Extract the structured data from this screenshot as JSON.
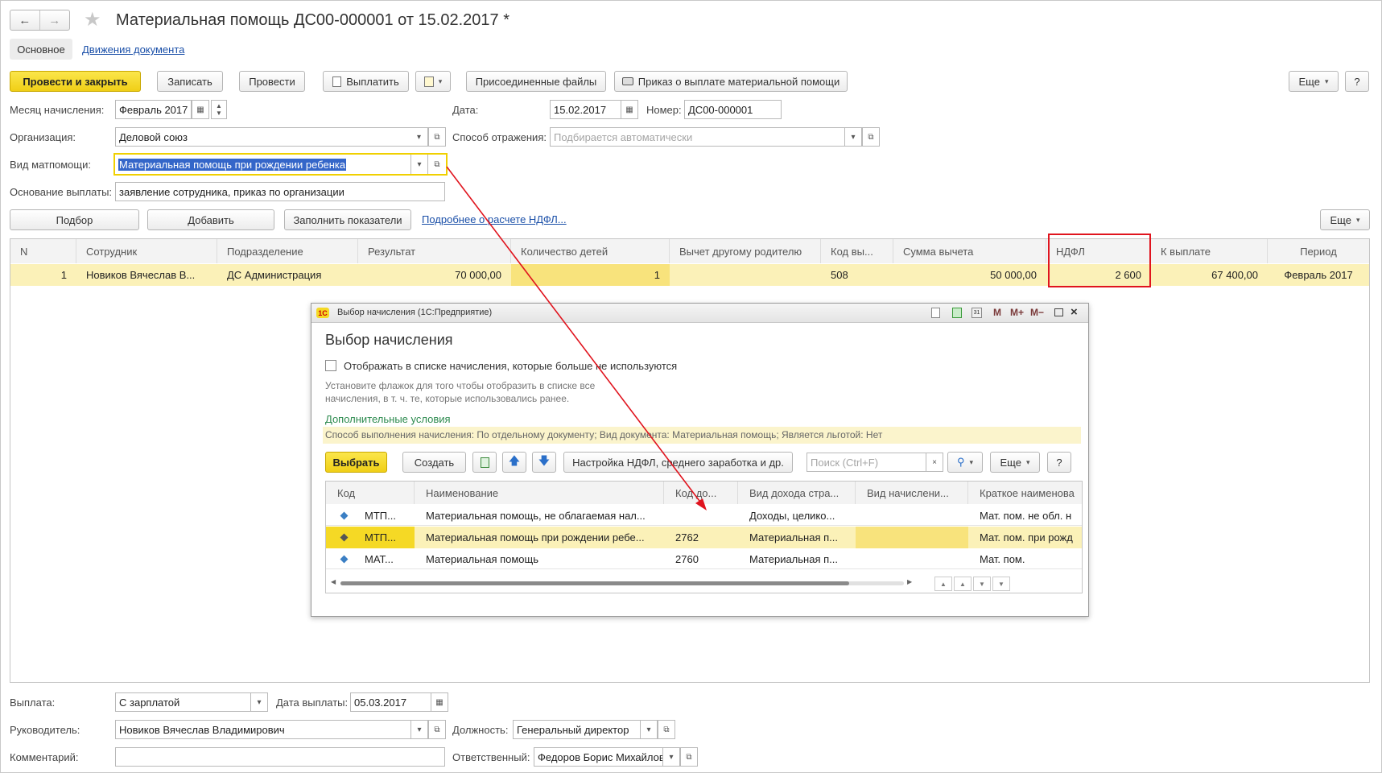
{
  "header": {
    "title": "Материальная помощь ДС00-000001 от 15.02.2017 *",
    "tabs": [
      "Основное",
      "Движения документа"
    ]
  },
  "toolbar": {
    "post_close": "Провести и закрыть",
    "save": "Записать",
    "post": "Провести",
    "pay": "Выплатить",
    "attached": "Присоединенные файлы",
    "order": "Приказ о выплате материальной помощи",
    "more": "Еще",
    "help": "?"
  },
  "form": {
    "month_label": "Месяц начисления:",
    "month_value": "Февраль 2017",
    "date_label": "Дата:",
    "date_value": "15.02.2017",
    "number_label": "Номер:",
    "number_value": "ДС00-000001",
    "org_label": "Организация:",
    "org_value": "Деловой союз",
    "reflect_label": "Способ отражения:",
    "reflect_placeholder": "Подбирается автоматически",
    "type_label": "Вид матпомощи:",
    "type_value": "Материальная помощь при рождении ребенка",
    "basis_label": "Основание выплаты:",
    "basis_value": "заявление сотрудника, приказ по организации"
  },
  "table_toolbar": {
    "select": "Подбор",
    "add": "Добавить",
    "fill": "Заполнить показатели",
    "ndfl_link": "Подробнее о расчете НДФЛ...",
    "more": "Еще"
  },
  "table": {
    "headers": [
      "N",
      "Сотрудник",
      "Подразделение",
      "Результат",
      "Количество детей",
      "Вычет другому родителю",
      "Код вы...",
      "Сумма вычета",
      "НДФЛ",
      "К выплате",
      "Период"
    ],
    "rows": [
      [
        "1",
        "Новиков Вячеслав В...",
        "ДС Администрация",
        "70 000,00",
        "1",
        "",
        "508",
        "50 000,00",
        "2 600",
        "67 400,00",
        "Февраль 2017"
      ]
    ]
  },
  "dialog": {
    "window_title": "Выбор начисления (1С:Предприятие)",
    "title": "Выбор начисления",
    "checkbox_label": "Отображать в списке начисления, которые больше не используются",
    "hint_line1": "Установите флажок для того чтобы отобразить в списке все",
    "hint_line2": "начисления, в т. ч. те, которые использовались ранее.",
    "extra_conditions": "Дополнительные условия",
    "conditions_text": "Способ выполнения начисления: По отдельному документу; Вид документа: Материальная помощь; Является льготой: Нет",
    "select_btn": "Выбрать",
    "create_btn": "Создать",
    "settings_btn": "Настройка НДФЛ, среднего заработка и др.",
    "search_placeholder": "Поиск (Ctrl+F)",
    "more_btn": "Еще",
    "help_btn": "?",
    "headers": [
      "Код",
      "Наименование",
      "Код до...",
      "Вид дохода стра...",
      "Вид начислени...",
      "Краткое наименова"
    ],
    "rows": [
      [
        "МТП...",
        "Материальная помощь, не облагаемая нал...",
        "",
        "Доходы, целико...",
        "",
        "Мат. пом. не обл. н"
      ],
      [
        "МТП...",
        "Материальная помощь при рождении ребе...",
        "2762",
        "Материальная п...",
        "",
        "Мат. пом. при рожд"
      ],
      [
        "МАТ...",
        "Материальная помощь",
        "2760",
        "Материальная п...",
        "",
        "Мат. пом."
      ]
    ]
  },
  "footer": {
    "payment_label": "Выплата:",
    "payment_value": "С зарплатой",
    "pay_date_label": "Дата выплаты:",
    "pay_date_value": "05.03.2017",
    "head_label": "Руководитель:",
    "head_value": "Новиков Вячеслав Владимирович",
    "position_label": "Должность:",
    "position_value": "Генеральный директор",
    "comment_label": "Комментарий:",
    "responsible_label": "Ответственный:",
    "responsible_value": "Федоров Борис Михайлов"
  },
  "colors": {
    "accent_yellow": "#f5d925",
    "selected_row": "#fbf1b8",
    "highlight_red": "#e0141e",
    "link_blue": "#1a4fa8"
  }
}
